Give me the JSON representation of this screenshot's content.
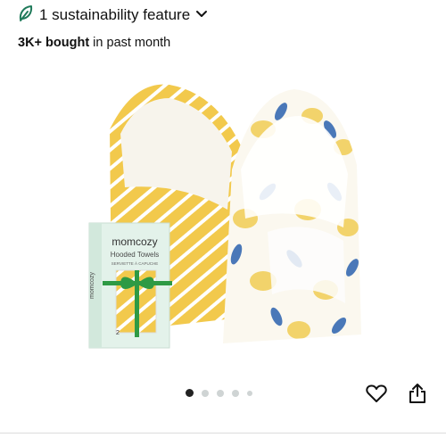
{
  "sustainability": {
    "label": "1 sustainability feature",
    "icon": "leaf-icon",
    "icon_color": "#1f7a5a"
  },
  "purchases": {
    "count": "3K+ bought",
    "suffix": " in past month"
  },
  "product_image": {
    "brand": "momcozy",
    "box_title": "Hooded Towels",
    "box_subtitle": "SERVIETTE À CAPUCHE",
    "box_count": "2",
    "box_side": "momcozy",
    "colors": {
      "yellow": "#f2c94c",
      "blue": "#4a78b8",
      "ribbon": "#2e9a44",
      "box": "#e3f2ea"
    }
  },
  "carousel": {
    "count": 5,
    "active_index": 0
  },
  "actions": {
    "wishlist_icon": "heart-icon",
    "share_icon": "share-icon"
  }
}
